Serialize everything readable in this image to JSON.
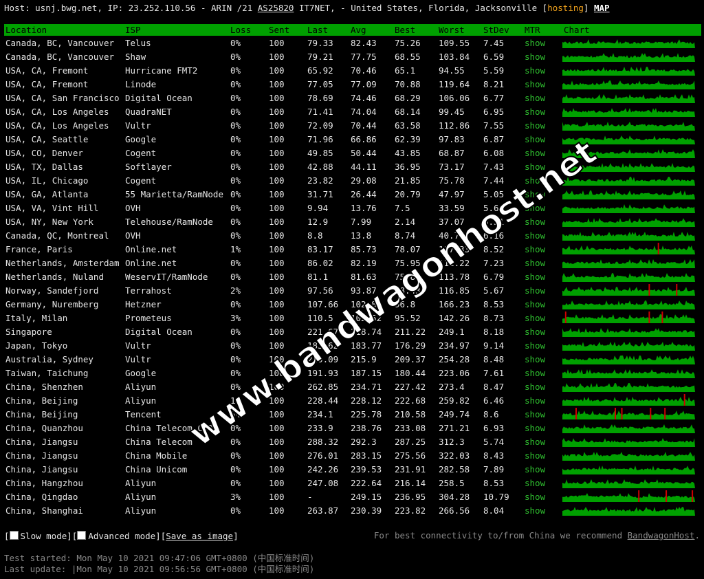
{
  "header": {
    "prefix": "Host: usnj.bwg.net, IP: 23.252.110.56 - ARIN /21 ",
    "asn": "AS25820",
    "suffix": " IT7NET, - United States, Florida, Jacksonville [",
    "hosting": "hosting",
    "close": "]",
    "map": "MAP"
  },
  "columns": [
    "Location",
    "ISP",
    "Loss",
    "Sent",
    "Last",
    "Avg",
    "Best",
    "Worst",
    "StDev",
    "MTR",
    "Chart"
  ],
  "rows": [
    {
      "location": "Canada, BC, Vancouver",
      "isp": "Telus",
      "loss": "0%",
      "sent": "100",
      "last": "79.33",
      "avg": "82.43",
      "best": "75.26",
      "worst": "109.55",
      "stdev": "7.45",
      "mtr": "show",
      "spikes": []
    },
    {
      "location": "Canada, BC, Vancouver",
      "isp": "Shaw",
      "loss": "0%",
      "sent": "100",
      "last": "79.21",
      "avg": "77.75",
      "best": "68.55",
      "worst": "103.84",
      "stdev": "6.59",
      "mtr": "show",
      "spikes": []
    },
    {
      "location": "USA, CA, Fremont",
      "isp": "Hurricane FMT2",
      "loss": "0%",
      "sent": "100",
      "last": "65.92",
      "avg": "70.46",
      "best": "65.1",
      "worst": "94.55",
      "stdev": "5.59",
      "mtr": "show",
      "spikes": []
    },
    {
      "location": "USA, CA, Fremont",
      "isp": "Linode",
      "loss": "0%",
      "sent": "100",
      "last": "77.05",
      "avg": "77.09",
      "best": "70.88",
      "worst": "119.64",
      "stdev": "8.21",
      "mtr": "show",
      "spikes": []
    },
    {
      "location": "USA, CA, San Francisco",
      "isp": "Digital Ocean",
      "loss": "0%",
      "sent": "100",
      "last": "78.69",
      "avg": "74.46",
      "best": "68.29",
      "worst": "106.06",
      "stdev": "6.77",
      "mtr": "show",
      "spikes": []
    },
    {
      "location": "USA, CA, Los Angeles",
      "isp": "QuadraNET",
      "loss": "0%",
      "sent": "100",
      "last": "71.41",
      "avg": "74.04",
      "best": "68.14",
      "worst": "99.45",
      "stdev": "6.95",
      "mtr": "show",
      "spikes": []
    },
    {
      "location": "USA, CA, Los Angeles",
      "isp": "Vultr",
      "loss": "0%",
      "sent": "100",
      "last": "72.09",
      "avg": "70.44",
      "best": "63.58",
      "worst": "112.86",
      "stdev": "7.55",
      "mtr": "show",
      "spikes": []
    },
    {
      "location": "USA, CA, Seattle",
      "isp": "Google",
      "loss": "0%",
      "sent": "100",
      "last": "71.96",
      "avg": "66.86",
      "best": "62.39",
      "worst": "97.83",
      "stdev": "6.87",
      "mtr": "show",
      "spikes": []
    },
    {
      "location": "USA, CO, Denver",
      "isp": "Cogent",
      "loss": "0%",
      "sent": "100",
      "last": "49.85",
      "avg": "50.44",
      "best": "43.85",
      "worst": "68.87",
      "stdev": "6.08",
      "mtr": "show",
      "spikes": []
    },
    {
      "location": "USA, TX, Dallas",
      "isp": "Softlayer",
      "loss": "0%",
      "sent": "100",
      "last": "42.88",
      "avg": "44.11",
      "best": "36.95",
      "worst": "73.17",
      "stdev": "7.43",
      "mtr": "show",
      "spikes": []
    },
    {
      "location": "USA, IL, Chicago",
      "isp": "Cogent",
      "loss": "0%",
      "sent": "100",
      "last": "23.82",
      "avg": "29.08",
      "best": "21.85",
      "worst": "75.78",
      "stdev": "7.44",
      "mtr": "show",
      "spikes": []
    },
    {
      "location": "USA, GA, Atlanta",
      "isp": "55 Marietta/RamNode",
      "loss": "0%",
      "sent": "100",
      "last": "31.71",
      "avg": "26.44",
      "best": "20.79",
      "worst": "47.97",
      "stdev": "5.05",
      "mtr": "show",
      "spikes": []
    },
    {
      "location": "USA, VA, Vint Hill",
      "isp": "OVH",
      "loss": "0%",
      "sent": "100",
      "last": "9.94",
      "avg": "13.76",
      "best": "7.5",
      "worst": "33.59",
      "stdev": "5.64",
      "mtr": "show",
      "spikes": []
    },
    {
      "location": "USA, NY, New York",
      "isp": "Telehouse/RamNode",
      "loss": "0%",
      "sent": "100",
      "last": "12.9",
      "avg": "7.99",
      "best": "2.14",
      "worst": "37.07",
      "stdev": "6.31",
      "mtr": "show",
      "spikes": []
    },
    {
      "location": "Canada, QC, Montreal",
      "isp": "OVH",
      "loss": "0%",
      "sent": "100",
      "last": "8.8",
      "avg": "13.8",
      "best": "8.74",
      "worst": "40.75",
      "stdev": "6.16",
      "mtr": "show",
      "spikes": []
    },
    {
      "location": "France, Paris",
      "isp": "Online.net",
      "loss": "1%",
      "sent": "100",
      "last": "83.17",
      "avg": "85.73",
      "best": "78.07",
      "worst": "117.33",
      "stdev": "8.52",
      "mtr": "show",
      "spikes": [
        0.73
      ]
    },
    {
      "location": "Netherlands, Amsterdam",
      "isp": "Online.net",
      "loss": "0%",
      "sent": "100",
      "last": "86.02",
      "avg": "82.19",
      "best": "75.95",
      "worst": "111.22",
      "stdev": "7.23",
      "mtr": "show",
      "spikes": []
    },
    {
      "location": "Netherlands, Nuland",
      "isp": "WeservIT/RamNode",
      "loss": "0%",
      "sent": "100",
      "last": "81.1",
      "avg": "81.63",
      "best": "75.82",
      "worst": "113.78",
      "stdev": "6.79",
      "mtr": "show",
      "spikes": []
    },
    {
      "location": "Norway, Sandefjord",
      "isp": "Terrahost",
      "loss": "2%",
      "sent": "100",
      "last": "97.56",
      "avg": "93.87",
      "best": "88.43",
      "worst": "116.85",
      "stdev": "5.67",
      "mtr": "show",
      "spikes": [
        0.66,
        0.87
      ]
    },
    {
      "location": "Germany, Nuremberg",
      "isp": "Hetzner",
      "loss": "0%",
      "sent": "100",
      "last": "107.66",
      "avg": "102.88",
      "best": "96.8",
      "worst": "166.23",
      "stdev": "8.53",
      "mtr": "show",
      "spikes": []
    },
    {
      "location": "Italy, Milan",
      "isp": "Prometeus",
      "loss": "3%",
      "sent": "100",
      "last": "110.5",
      "avg": "102.52",
      "best": "95.52",
      "worst": "142.26",
      "stdev": "8.73",
      "mtr": "show",
      "spikes": [
        0.02,
        0.66,
        0.76
      ]
    },
    {
      "location": "Singapore",
      "isp": "Digital Ocean",
      "loss": "0%",
      "sent": "100",
      "last": "221.67",
      "avg": "218.74",
      "best": "211.22",
      "worst": "249.1",
      "stdev": "8.18",
      "mtr": "show",
      "spikes": []
    },
    {
      "location": "Japan, Tokyo",
      "isp": "Vultr",
      "loss": "0%",
      "sent": "100",
      "last": "183.62",
      "avg": "183.77",
      "best": "176.29",
      "worst": "234.97",
      "stdev": "9.14",
      "mtr": "show",
      "spikes": []
    },
    {
      "location": "Australia, Sydney",
      "isp": "Vultr",
      "loss": "0%",
      "sent": "100",
      "last": "210.09",
      "avg": "215.9",
      "best": "209.37",
      "worst": "254.28",
      "stdev": "8.48",
      "mtr": "show",
      "spikes": []
    },
    {
      "location": "Taiwan, Taichung",
      "isp": "Google",
      "loss": "0%",
      "sent": "100",
      "last": "191.93",
      "avg": "187.15",
      "best": "180.44",
      "worst": "223.06",
      "stdev": "7.61",
      "mtr": "show",
      "spikes": []
    },
    {
      "location": "China, Shenzhen",
      "isp": "Aliyun",
      "loss": "0%",
      "sent": "100",
      "last": "262.85",
      "avg": "234.71",
      "best": "227.42",
      "worst": "273.4",
      "stdev": "8.47",
      "mtr": "show",
      "spikes": []
    },
    {
      "location": "China, Beijing",
      "isp": "Aliyun",
      "loss": "1%",
      "sent": "100",
      "last": "228.44",
      "avg": "228.12",
      "best": "222.68",
      "worst": "259.82",
      "stdev": "6.46",
      "mtr": "show",
      "spikes": [
        0.93
      ]
    },
    {
      "location": "China, Beijing",
      "isp": "Tencent",
      "loss": "5%",
      "sent": "100",
      "last": "234.1",
      "avg": "225.78",
      "best": "210.58",
      "worst": "249.74",
      "stdev": "8.6",
      "mtr": "show",
      "spikes": [
        0.1,
        0.4,
        0.45,
        0.67,
        0.78
      ]
    },
    {
      "location": "China, Quanzhou",
      "isp": "China Telecom CN2",
      "loss": "0%",
      "sent": "100",
      "last": "233.9",
      "avg": "238.76",
      "best": "233.08",
      "worst": "271.21",
      "stdev": "6.93",
      "mtr": "show",
      "spikes": []
    },
    {
      "location": "China, Jiangsu",
      "isp": "China Telecom",
      "loss": "0%",
      "sent": "100",
      "last": "288.32",
      "avg": "292.3",
      "best": "287.25",
      "worst": "312.3",
      "stdev": "5.74",
      "mtr": "show",
      "spikes": []
    },
    {
      "location": "China, Jiangsu",
      "isp": "China Mobile",
      "loss": "0%",
      "sent": "100",
      "last": "276.01",
      "avg": "283.15",
      "best": "275.56",
      "worst": "322.03",
      "stdev": "8.43",
      "mtr": "show",
      "spikes": []
    },
    {
      "location": "China, Jiangsu",
      "isp": "China Unicom",
      "loss": "0%",
      "sent": "100",
      "last": "242.26",
      "avg": "239.53",
      "best": "231.91",
      "worst": "282.58",
      "stdev": "7.89",
      "mtr": "show",
      "spikes": []
    },
    {
      "location": "China, Hangzhou",
      "isp": "Aliyun",
      "loss": "0%",
      "sent": "100",
      "last": "247.08",
      "avg": "222.64",
      "best": "216.14",
      "worst": "258.5",
      "stdev": "8.53",
      "mtr": "show",
      "spikes": []
    },
    {
      "location": "China, Qingdao",
      "isp": "Aliyun",
      "loss": "3%",
      "sent": "100",
      "last": "-",
      "avg": "249.15",
      "best": "236.95",
      "worst": "304.28",
      "stdev": "10.79",
      "mtr": "show",
      "spikes": [
        0.58,
        0.79,
        0.99
      ]
    },
    {
      "location": "China, Shanghai",
      "isp": "Aliyun",
      "loss": "0%",
      "sent": "100",
      "last": "263.87",
      "avg": "230.39",
      "best": "223.82",
      "worst": "266.56",
      "stdev": "8.04",
      "mtr": "show",
      "spikes": []
    }
  ],
  "options": {
    "open1": "[",
    "slow": "Slow mode",
    "mid1": "][",
    "advanced": "Advanced mode",
    "mid2": "][",
    "save": "Save as image",
    "close": "]"
  },
  "recommend": {
    "text": "For best connectivity to/from China we recommend ",
    "link": "BandwagonHost",
    "end": "."
  },
  "times": {
    "started": "Test started: Mon May 10 2021 09:47:06 GMT+0800 (中国标准时间)",
    "updated": "Last update: |Mon May 10 2021 09:56:56 GMT+0800 (中国标准时间)"
  },
  "watermark": "www.bandwagonhost.net",
  "colors": {
    "accent_green": "#00a000",
    "mtr_link": "#2fbf2f",
    "loss_spike": "#d00000",
    "hosting": "#f4a41c"
  }
}
